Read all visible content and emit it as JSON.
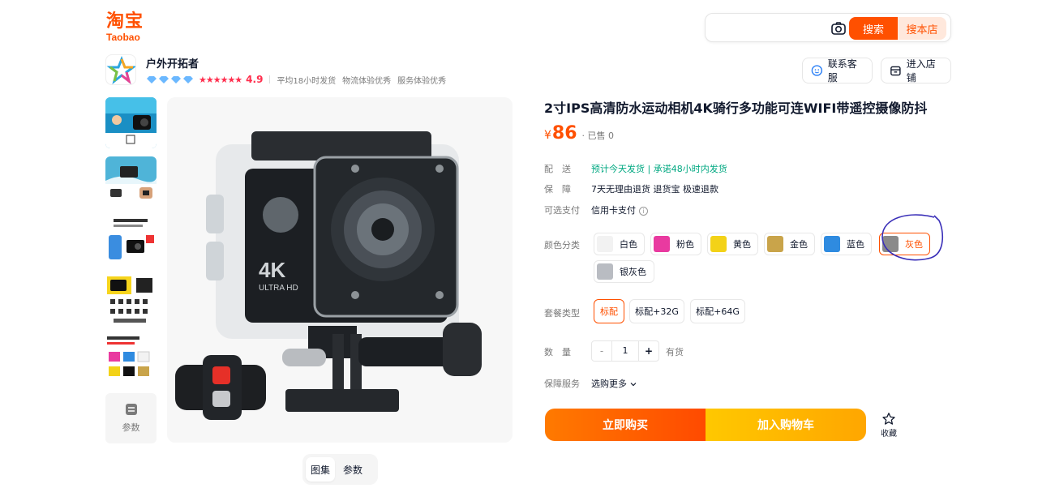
{
  "brand": {
    "logo_cn": "淘宝",
    "logo_en": "Taobao",
    "accent": "#ff5000"
  },
  "search": {
    "placeholder": "",
    "search_label": "搜索",
    "store_search_label": "搜本店"
  },
  "shop": {
    "name": "户外开拓者",
    "rating": "4.9",
    "stars": "★★★★★★",
    "metrics": [
      "平均18小时发货",
      "物流体验优秀",
      "服务体验优秀"
    ],
    "service_label": "联系客服",
    "enter_store_label": "进入店铺"
  },
  "gallery": {
    "param_label": "参数",
    "tabs": [
      {
        "label": "图集",
        "active": true
      },
      {
        "label": "参数",
        "active": false
      }
    ],
    "main_image_badge": "4K",
    "main_image_sub": "ULTRA HD"
  },
  "product": {
    "title": "2寸IPS高清防水运动相机4K骑行多功能可连WIFI带遥控摄像防抖",
    "currency": "¥",
    "price": "86",
    "sold": "· 已售 0",
    "delivery_label": "配　送",
    "delivery_value": "预计今天发货 | 承诺48小时内发货",
    "guarantee_label": "保　障",
    "guarantee_value": "7天无理由退货 退货宝 极速退款",
    "payment_label": "可选支付",
    "payment_value": "信用卡支付",
    "color_label": "颜色分类",
    "colors": [
      {
        "label": "白色",
        "swatch": "#f2f2f2",
        "selected": false
      },
      {
        "label": "粉色",
        "swatch": "#e93aa0",
        "selected": false
      },
      {
        "label": "黄色",
        "swatch": "#f3d218",
        "selected": false
      },
      {
        "label": "金色",
        "swatch": "#c9a44a",
        "selected": false
      },
      {
        "label": "蓝色",
        "swatch": "#2f8be0",
        "selected": false
      },
      {
        "label": "灰色",
        "swatch": "#8a8a8a",
        "selected": true
      },
      {
        "label": "银灰色",
        "swatch": "#b9bcc2",
        "selected": false
      }
    ],
    "package_label": "套餐类型",
    "packages": [
      {
        "label": "标配",
        "selected": true
      },
      {
        "label": "标配+32G",
        "selected": false
      },
      {
        "label": "标配+64G",
        "selected": false
      }
    ],
    "qty_label": "数　量",
    "qty_minus": "-",
    "qty_value": "1",
    "qty_plus": "+",
    "stock": "有货",
    "protection_label": "保障服务",
    "protection_value": "选购更多",
    "buy_now": "立即购买",
    "add_cart": "加入购物车",
    "favorite": "收藏"
  }
}
